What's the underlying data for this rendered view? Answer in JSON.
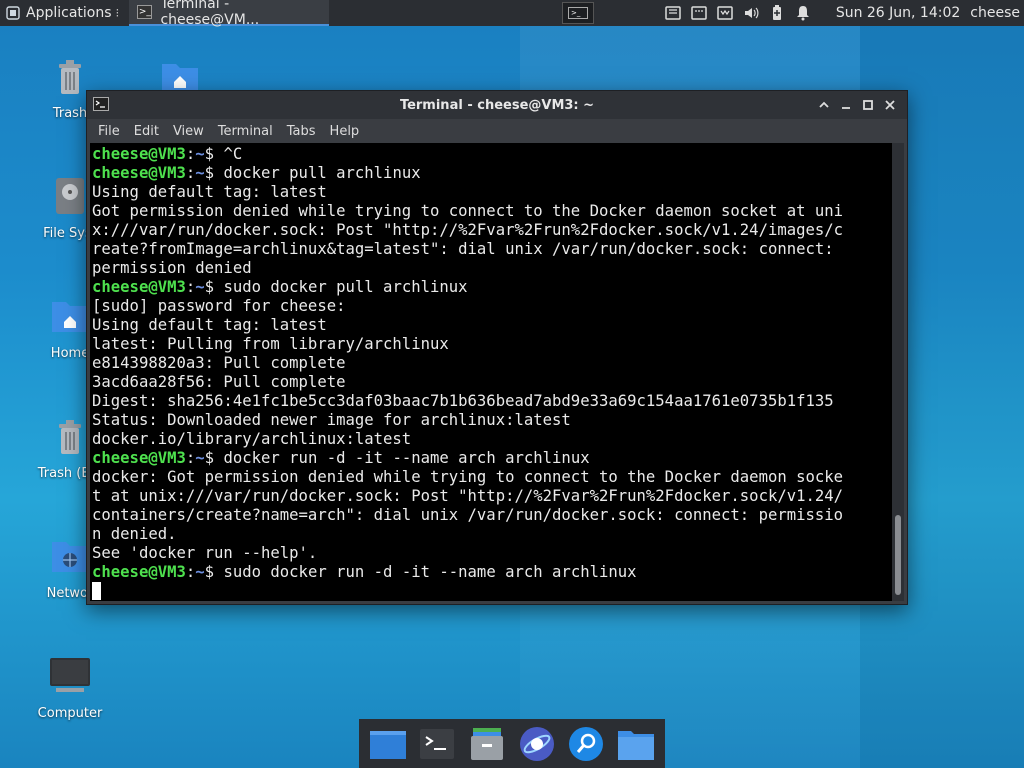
{
  "top_panel": {
    "apps_label": "Applications",
    "task_title": "Terminal - cheese@VM...",
    "clock": "Sun 26 Jun, 14:02",
    "user": "cheese"
  },
  "desktop": {
    "icons": [
      {
        "label": "Trash"
      },
      {
        "label": "File Syst"
      },
      {
        "label": "Home"
      },
      {
        "label": "Trash (Em"
      },
      {
        "label": "Networ"
      },
      {
        "label": "Computer"
      }
    ]
  },
  "window": {
    "title": "Terminal - cheese@VM3: ~",
    "menu": [
      "File",
      "Edit",
      "View",
      "Terminal",
      "Tabs",
      "Help"
    ]
  },
  "terminal": {
    "user_host": "cheese@VM3",
    "path": "~",
    "lines": [
      {
        "prompt": true,
        "cmd": "^C"
      },
      {
        "prompt": true,
        "cmd": "docker pull archlinux"
      },
      {
        "text": "Using default tag: latest"
      },
      {
        "text": "Got permission denied while trying to connect to the Docker daemon socket at uni"
      },
      {
        "text": "x:///var/run/docker.sock: Post \"http://%2Fvar%2Frun%2Fdocker.sock/v1.24/images/c"
      },
      {
        "text": "reate?fromImage=archlinux&tag=latest\": dial unix /var/run/docker.sock: connect:"
      },
      {
        "text": "permission denied"
      },
      {
        "prompt": true,
        "cmd": "sudo docker pull archlinux"
      },
      {
        "text": "[sudo] password for cheese:"
      },
      {
        "text": "Using default tag: latest"
      },
      {
        "text": "latest: Pulling from library/archlinux"
      },
      {
        "text": "e814398820a3: Pull complete"
      },
      {
        "text": "3acd6aa28f56: Pull complete"
      },
      {
        "text": "Digest: sha256:4e1fc1be5cc3daf03baac7b1b636bead7abd9e33a69c154aa1761e0735b1f135"
      },
      {
        "text": "Status: Downloaded newer image for archlinux:latest"
      },
      {
        "text": "docker.io/library/archlinux:latest"
      },
      {
        "prompt": true,
        "cmd": "docker run -d -it --name arch archlinux"
      },
      {
        "text": "docker: Got permission denied while trying to connect to the Docker daemon socke"
      },
      {
        "text": "t at unix:///var/run/docker.sock: Post \"http://%2Fvar%2Frun%2Fdocker.sock/v1.24/"
      },
      {
        "text": "containers/create?name=arch\": dial unix /var/run/docker.sock: connect: permissio"
      },
      {
        "text": "n denied."
      },
      {
        "text": "See 'docker run --help'."
      },
      {
        "prompt": true,
        "cmd": "sudo docker run -d -it --name arch archlinux"
      }
    ]
  },
  "colors": {
    "prompt_user": "#4ee04e",
    "prompt_path": "#6d8fe0",
    "panel": "#2b2e33"
  },
  "dock": {
    "items": [
      {
        "icon": "show-desktop-icon"
      },
      {
        "icon": "terminal-icon"
      },
      {
        "icon": "file-manager-icon"
      },
      {
        "icon": "web-browser-icon"
      },
      {
        "icon": "app-finder-icon"
      },
      {
        "icon": "folder-icon"
      }
    ]
  }
}
